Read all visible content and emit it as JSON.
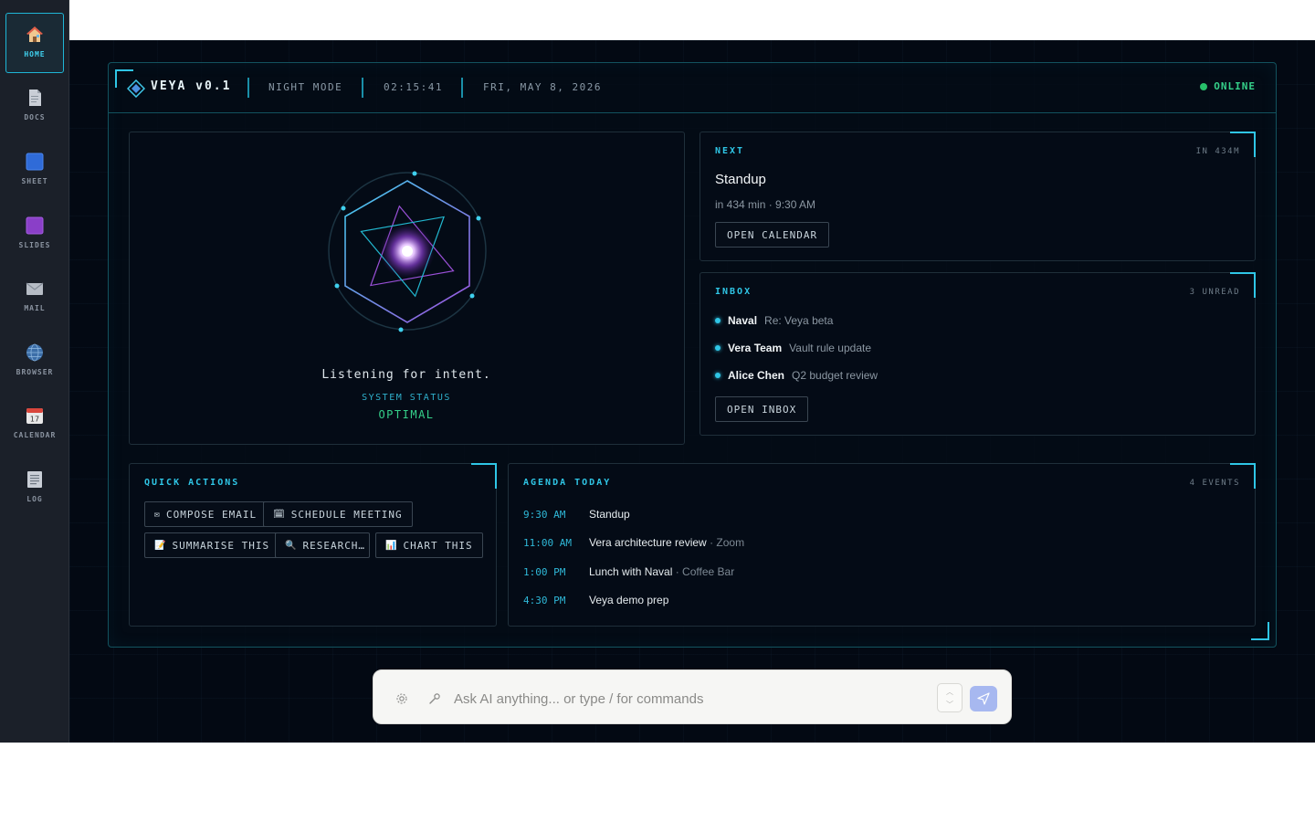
{
  "sidebar": {
    "items": [
      {
        "label": "HOME",
        "icon": "home-icon",
        "active": true
      },
      {
        "label": "DOCS",
        "icon": "document-icon"
      },
      {
        "label": "SHEET",
        "icon": "sheet-icon"
      },
      {
        "label": "SLIDES",
        "icon": "slides-icon"
      },
      {
        "label": "MAIL",
        "icon": "mail-icon"
      },
      {
        "label": "BROWSER",
        "icon": "globe-icon"
      },
      {
        "label": "CALENDAR",
        "icon": "calendar-icon",
        "date_number": "17"
      },
      {
        "label": "LOG",
        "icon": "log-icon"
      }
    ]
  },
  "header": {
    "brand": "VEYA v0.1",
    "mode": "NIGHT MODE",
    "time": "02:15:41",
    "date": "FRI, MAY 8, 2026",
    "status": "ONLINE"
  },
  "core": {
    "prompt": "Listening for intent.",
    "status_label": "SYSTEM STATUS",
    "status_value": "OPTIMAL"
  },
  "next": {
    "title": "NEXT",
    "meta": "IN 434M",
    "event": "Standup",
    "detail": "in 434 min · 9:30 AM",
    "button": "OPEN CALENDAR"
  },
  "inbox": {
    "title": "INBOX",
    "meta": "3 UNREAD",
    "messages": [
      {
        "from": "Naval",
        "subject": "Re: Veya beta"
      },
      {
        "from": "Vera Team",
        "subject": "Vault rule update"
      },
      {
        "from": "Alice Chen",
        "subject": "Q2 budget review"
      }
    ],
    "button": "OPEN INBOX"
  },
  "quick_actions": {
    "title": "QUICK ACTIONS",
    "buttons": [
      {
        "icon": "✉",
        "label": "COMPOSE EMAIL"
      },
      {
        "icon": "🗓",
        "label": "SCHEDULE MEETING"
      },
      {
        "icon": "📝",
        "label": "SUMMARISE THIS"
      },
      {
        "icon": "🔍",
        "label": "RESEARCH…"
      },
      {
        "icon": "📊",
        "label": "CHART THIS"
      }
    ]
  },
  "agenda": {
    "title": "AGENDA TODAY",
    "meta": "4 EVENTS",
    "events": [
      {
        "time": "9:30 AM",
        "title": "Standup",
        "location": ""
      },
      {
        "time": "11:00 AM",
        "title": "Vera architecture review",
        "location": " · Zoom"
      },
      {
        "time": "1:00 PM",
        "title": "Lunch with Naval",
        "location": " · Coffee Bar"
      },
      {
        "time": "4:30 PM",
        "title": "Veya demo prep",
        "location": ""
      }
    ]
  },
  "command": {
    "placeholder": "Ask AI anything... or type / for commands"
  },
  "colors": {
    "accent": "#2fc6e6",
    "online": "#27c06a",
    "status_optimal": "#35d08a"
  }
}
